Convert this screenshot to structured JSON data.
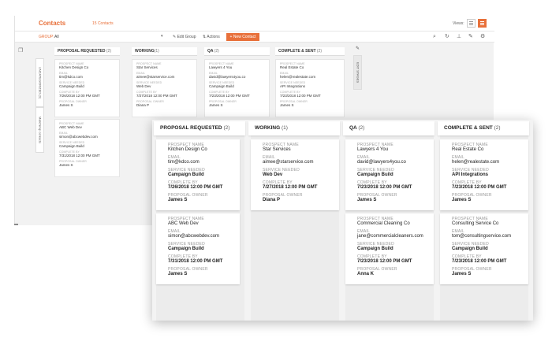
{
  "background_app": {
    "title": "Contacts",
    "count": "15 Contacts",
    "views_label": "Views:",
    "toolbar": {
      "group_label": "GROUP:",
      "group_value": "All",
      "edit_group": "✎ Edit Group",
      "actions": "⇅ Actions",
      "new_contact": "+ New Contact"
    },
    "vertical_tabs": [
      {
        "label": "UNCATEGORIZED (0)"
      },
      {
        "label": "Mailchimp contacts"
      },
      {
        "label": "EDIT STAGES"
      }
    ],
    "columns": [
      {
        "name": "PROPOSAL REQUESTED",
        "count": "(2)",
        "cards": [
          {
            "prospect": "Kitchen Design Co",
            "email": "tim@kdco.com",
            "service": "Campaign Build",
            "complete_by": "7/26/2018 12:00 PM GMT",
            "owner": "James S"
          },
          {
            "prospect": "ABC Web Dev",
            "email": "simon@abcwebdev.com",
            "service": "Campaign Build",
            "complete_by": "7/31/2018 12:00 PM GMT",
            "owner": "James S"
          }
        ]
      },
      {
        "name": "WORKING",
        "count": "(1)",
        "cards": [
          {
            "prospect": "Star Services",
            "email": "aimee@starservice.com",
            "service": "Web Dev",
            "complete_by": "7/27/2018 12:00 PM GMT",
            "owner": "Diana P"
          }
        ]
      },
      {
        "name": "QA",
        "count": "(2)",
        "cards": [
          {
            "prospect": "Lawyers 4 You",
            "email": "david@lawyers4you.co",
            "service": "Campaign Build",
            "complete_by": "7/23/2018 12:00 PM GMT",
            "owner": "James S"
          }
        ]
      },
      {
        "name": "COMPLETE & SENT",
        "count": "(2)",
        "cards": [
          {
            "prospect": "Real Estate Co",
            "email": "helen@realestate.com",
            "service": "API Integrations",
            "complete_by": "7/23/2018 12:00 PM GMT",
            "owner": "James S"
          }
        ]
      }
    ]
  },
  "field_labels": {
    "prospect": "PROSPECT NAME",
    "email": "EMAIL",
    "service": "SERVICE NEEDED",
    "complete_by": "COMPLETE BY",
    "owner": "PROPOSAL OWNER"
  },
  "board": {
    "columns": [
      {
        "name": "PROPOSAL REQUESTED",
        "count": "(2)",
        "cards": [
          {
            "prospect": "Kitchen Design Co",
            "email": "tim@kdco.com",
            "service": "Campaign Build",
            "complete_by": "7/26/2018 12:00 PM GMT",
            "owner": "James S"
          },
          {
            "prospect": "ABC Web Dev",
            "email": "simon@abcwebdev.com",
            "service": "Campaign Build",
            "complete_by": "7/31/2018 12:00 PM GMT",
            "owner": "James S"
          }
        ]
      },
      {
        "name": "WORKING",
        "count": "(1)",
        "cards": [
          {
            "prospect": "Star Services",
            "email": "aimee@starservice.com",
            "service": "Web Dev",
            "complete_by": "7/27/2018 12:00 PM GMT",
            "owner": "Diana P"
          }
        ]
      },
      {
        "name": "QA",
        "count": "(2)",
        "cards": [
          {
            "prospect": "Lawyers 4 You",
            "email": "david@lawyers4you.co",
            "service": "Campaign Build",
            "complete_by": "7/23/2018 12:00 PM GMT",
            "owner": "James S"
          },
          {
            "prospect": "Commercial Cleaning Co",
            "email": "jane@commercialcleaners.com",
            "service": "Campaign Build",
            "complete_by": "7/23/2018 12:00 PM GMT",
            "owner": "Anna K"
          }
        ]
      },
      {
        "name": "COMPLETE & SENT",
        "count": "(2)",
        "cards": [
          {
            "prospect": "Real Estate Co",
            "email": "helen@realestate.com",
            "service": "API Integrations",
            "complete_by": "7/23/2018 12:00 PM GMT",
            "owner": "James S"
          },
          {
            "prospect": "Consulting Service Co",
            "email": "tom@consultingservice.com",
            "service": "Campaign Build",
            "complete_by": "7/23/2018 12:00 PM GMT",
            "owner": "James S"
          }
        ]
      }
    ]
  },
  "colors": {
    "accent": "#e8703a"
  },
  "icons": [
    "search-icon",
    "refresh-icon",
    "pin-icon",
    "pencil-icon",
    "gear-icon",
    "list-view-icon",
    "board-view-icon",
    "sidebar-toggle-icon"
  ]
}
